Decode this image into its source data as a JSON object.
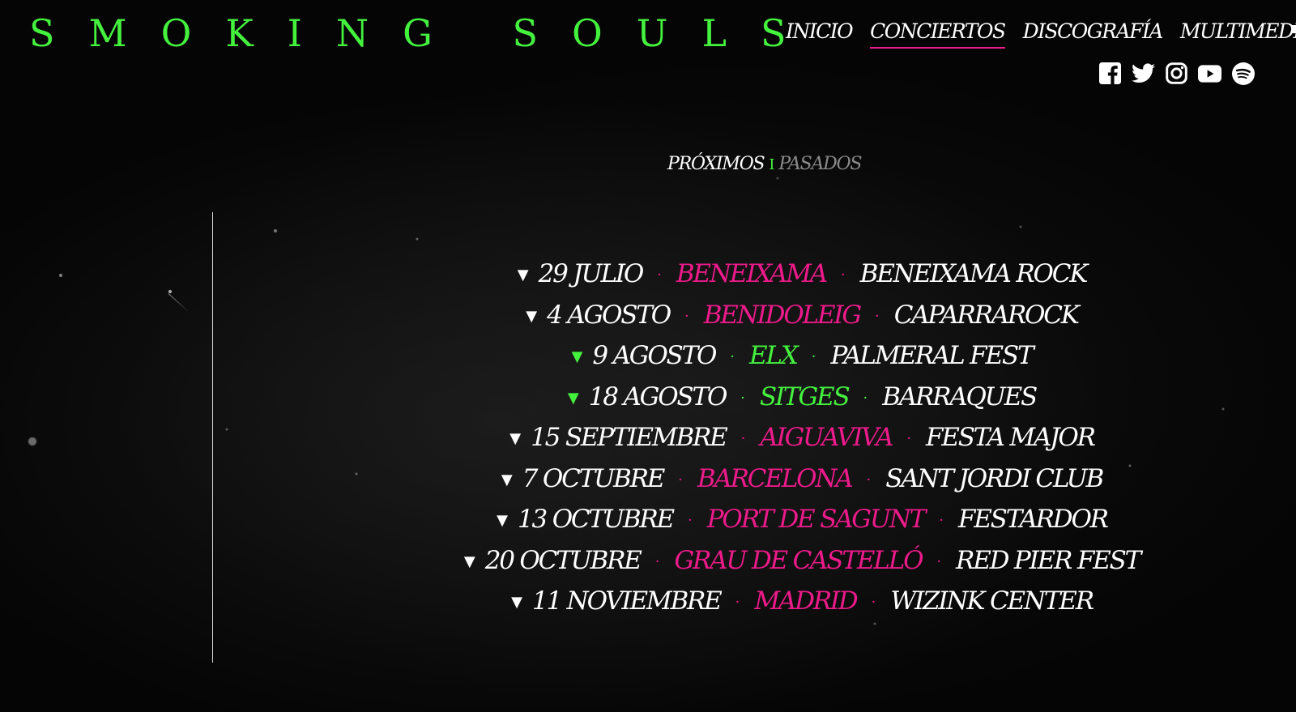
{
  "brand": {
    "logo": "SMOKING SOULS",
    "accent_green": "#44f23e",
    "accent_pink": "#ec1a8a"
  },
  "nav": {
    "items": [
      {
        "label": "INICIO",
        "active": false
      },
      {
        "label": "CONCIERTOS",
        "active": true
      },
      {
        "label": "DISCOGRAFÍA",
        "active": false
      },
      {
        "label": "MULTIMEDIA",
        "active": false
      }
    ]
  },
  "socials": [
    {
      "icon": "facebook-icon"
    },
    {
      "icon": "twitter-icon"
    },
    {
      "icon": "instagram-icon"
    },
    {
      "icon": "youtube-icon"
    },
    {
      "icon": "spotify-icon"
    }
  ],
  "tabs": {
    "upcoming": "PRÓXIMOS",
    "separator": "I",
    "past": "PASADOS"
  },
  "concerts": [
    {
      "caret": "▼",
      "date": "29 JULIO",
      "city": "BENEIXAMA",
      "venue": "BENEIXAMA ROCK",
      "color": "#ec1a8a"
    },
    {
      "caret": "▼",
      "date": "4 AGOSTO",
      "city": "BENIDOLEIG",
      "venue": "CAPARRAROCK",
      "color": "#ec1a8a"
    },
    {
      "caret": "▼",
      "date": "9 AGOSTO",
      "city": "ELX",
      "venue": "PALMERAL FEST",
      "color": "#44f23e"
    },
    {
      "caret": "▼",
      "date": "18 AGOSTO",
      "city": "SITGES",
      "venue": "BARRAQUES",
      "color": "#44f23e"
    },
    {
      "caret": "▼",
      "date": "15 SEPTIEMBRE",
      "city": "AIGUAVIVA",
      "venue": "FESTA MAJOR",
      "color": "#ec1a8a"
    },
    {
      "caret": "▼",
      "date": "7 OCTUBRE",
      "city": "BARCELONA",
      "venue": "SANT JORDI CLUB",
      "color": "#ec1a8a"
    },
    {
      "caret": "▼",
      "date": "13 OCTUBRE",
      "city": "PORT DE SAGUNT",
      "venue": "FESTARDOR",
      "color": "#ec1a8a"
    },
    {
      "caret": "▼",
      "date": "20 OCTUBRE",
      "city": "GRAU DE CASTELLÓ",
      "venue": "RED PIER FEST",
      "color": "#ec1a8a"
    },
    {
      "caret": "▼",
      "date": "11 NOVIEMBRE",
      "city": "MADRID",
      "venue": "WIZINK CENTER",
      "color": "#ec1a8a"
    }
  ]
}
